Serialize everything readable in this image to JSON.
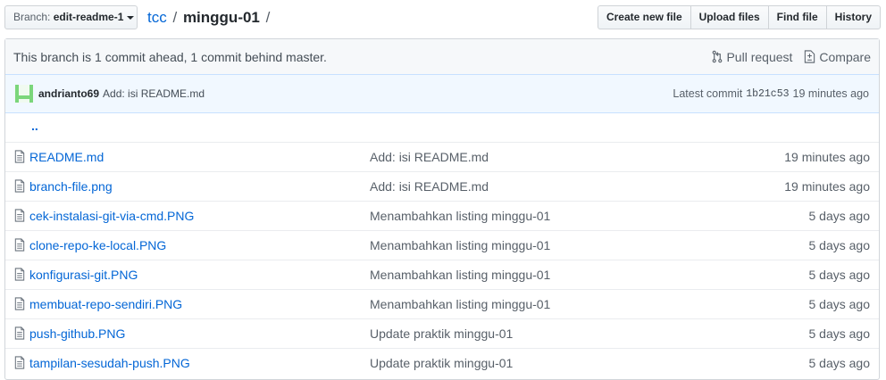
{
  "branch": {
    "prefix": "Branch: ",
    "name": "edit-readme-1"
  },
  "breadcrumb": {
    "repo": "tcc",
    "sep1": "/",
    "folder": "minggu-01",
    "sep2": "/"
  },
  "actions": [
    "Create new file",
    "Upload files",
    "Find file",
    "History"
  ],
  "branch_info": {
    "text": "This branch is 1 commit ahead, 1 commit behind master.",
    "pull_request": "Pull request",
    "compare": "Compare"
  },
  "latest_commit": {
    "author": "andrianto69",
    "message": "Add: isi README.md",
    "label": "Latest commit",
    "sha": "1b21c53",
    "age": "19 minutes ago"
  },
  "parent_dir": "..",
  "files": [
    {
      "name": "README.md",
      "message": "Add: isi README.md",
      "age": "19 minutes ago"
    },
    {
      "name": "branch-file.png",
      "message": "Add: isi README.md",
      "age": "19 minutes ago"
    },
    {
      "name": "cek-instalasi-git-via-cmd.PNG",
      "message": "Menambahkan listing minggu-01",
      "age": "5 days ago"
    },
    {
      "name": "clone-repo-ke-local.PNG",
      "message": "Menambahkan listing minggu-01",
      "age": "5 days ago"
    },
    {
      "name": "konfigurasi-git.PNG",
      "message": "Menambahkan listing minggu-01",
      "age": "5 days ago"
    },
    {
      "name": "membuat-repo-sendiri.PNG",
      "message": "Menambahkan listing minggu-01",
      "age": "5 days ago"
    },
    {
      "name": "push-github.PNG",
      "message": "Update praktik minggu-01",
      "age": "5 days ago"
    },
    {
      "name": "tampilan-sesudah-push.PNG",
      "message": "Update praktik minggu-01",
      "age": "5 days ago"
    }
  ],
  "icons": {
    "file": "file-icon",
    "pull_request": "git-pull-request-icon",
    "compare": "diff-icon",
    "avatar": "identicon-avatar"
  },
  "colors": {
    "link": "#0366d6",
    "commit_bar_bg": "#f1f8ff",
    "avatar": "#7bd67b"
  }
}
